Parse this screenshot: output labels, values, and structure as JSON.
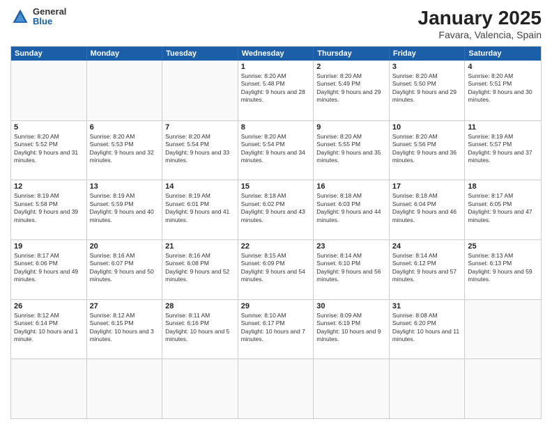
{
  "header": {
    "logo_general": "General",
    "logo_blue": "Blue",
    "title": "January 2025",
    "location": "Favara, Valencia, Spain"
  },
  "calendar": {
    "days_of_week": [
      "Sunday",
      "Monday",
      "Tuesday",
      "Wednesday",
      "Thursday",
      "Friday",
      "Saturday"
    ],
    "weeks": [
      [
        {
          "day": "",
          "empty": true
        },
        {
          "day": "",
          "empty": true
        },
        {
          "day": "",
          "empty": true
        },
        {
          "day": "1",
          "sunrise": "Sunrise: 8:20 AM",
          "sunset": "Sunset: 5:48 PM",
          "daylight": "Daylight: 9 hours and 28 minutes."
        },
        {
          "day": "2",
          "sunrise": "Sunrise: 8:20 AM",
          "sunset": "Sunset: 5:49 PM",
          "daylight": "Daylight: 9 hours and 29 minutes."
        },
        {
          "day": "3",
          "sunrise": "Sunrise: 8:20 AM",
          "sunset": "Sunset: 5:50 PM",
          "daylight": "Daylight: 9 hours and 29 minutes."
        },
        {
          "day": "4",
          "sunrise": "Sunrise: 8:20 AM",
          "sunset": "Sunset: 5:51 PM",
          "daylight": "Daylight: 9 hours and 30 minutes."
        }
      ],
      [
        {
          "day": "5",
          "sunrise": "Sunrise: 8:20 AM",
          "sunset": "Sunset: 5:52 PM",
          "daylight": "Daylight: 9 hours and 31 minutes."
        },
        {
          "day": "6",
          "sunrise": "Sunrise: 8:20 AM",
          "sunset": "Sunset: 5:53 PM",
          "daylight": "Daylight: 9 hours and 32 minutes."
        },
        {
          "day": "7",
          "sunrise": "Sunrise: 8:20 AM",
          "sunset": "Sunset: 5:54 PM",
          "daylight": "Daylight: 9 hours and 33 minutes."
        },
        {
          "day": "8",
          "sunrise": "Sunrise: 8:20 AM",
          "sunset": "Sunset: 5:54 PM",
          "daylight": "Daylight: 9 hours and 34 minutes."
        },
        {
          "day": "9",
          "sunrise": "Sunrise: 8:20 AM",
          "sunset": "Sunset: 5:55 PM",
          "daylight": "Daylight: 9 hours and 35 minutes."
        },
        {
          "day": "10",
          "sunrise": "Sunrise: 8:20 AM",
          "sunset": "Sunset: 5:56 PM",
          "daylight": "Daylight: 9 hours and 36 minutes."
        },
        {
          "day": "11",
          "sunrise": "Sunrise: 8:19 AM",
          "sunset": "Sunset: 5:57 PM",
          "daylight": "Daylight: 9 hours and 37 minutes."
        }
      ],
      [
        {
          "day": "12",
          "sunrise": "Sunrise: 8:19 AM",
          "sunset": "Sunset: 5:58 PM",
          "daylight": "Daylight: 9 hours and 39 minutes."
        },
        {
          "day": "13",
          "sunrise": "Sunrise: 8:19 AM",
          "sunset": "Sunset: 5:59 PM",
          "daylight": "Daylight: 9 hours and 40 minutes."
        },
        {
          "day": "14",
          "sunrise": "Sunrise: 8:19 AM",
          "sunset": "Sunset: 6:01 PM",
          "daylight": "Daylight: 9 hours and 41 minutes."
        },
        {
          "day": "15",
          "sunrise": "Sunrise: 8:18 AM",
          "sunset": "Sunset: 6:02 PM",
          "daylight": "Daylight: 9 hours and 43 minutes."
        },
        {
          "day": "16",
          "sunrise": "Sunrise: 8:18 AM",
          "sunset": "Sunset: 6:03 PM",
          "daylight": "Daylight: 9 hours and 44 minutes."
        },
        {
          "day": "17",
          "sunrise": "Sunrise: 8:18 AM",
          "sunset": "Sunset: 6:04 PM",
          "daylight": "Daylight: 9 hours and 46 minutes."
        },
        {
          "day": "18",
          "sunrise": "Sunrise: 8:17 AM",
          "sunset": "Sunset: 6:05 PM",
          "daylight": "Daylight: 9 hours and 47 minutes."
        }
      ],
      [
        {
          "day": "19",
          "sunrise": "Sunrise: 8:17 AM",
          "sunset": "Sunset: 6:06 PM",
          "daylight": "Daylight: 9 hours and 49 minutes."
        },
        {
          "day": "20",
          "sunrise": "Sunrise: 8:16 AM",
          "sunset": "Sunset: 6:07 PM",
          "daylight": "Daylight: 9 hours and 50 minutes."
        },
        {
          "day": "21",
          "sunrise": "Sunrise: 8:16 AM",
          "sunset": "Sunset: 6:08 PM",
          "daylight": "Daylight: 9 hours and 52 minutes."
        },
        {
          "day": "22",
          "sunrise": "Sunrise: 8:15 AM",
          "sunset": "Sunset: 6:09 PM",
          "daylight": "Daylight: 9 hours and 54 minutes."
        },
        {
          "day": "23",
          "sunrise": "Sunrise: 8:14 AM",
          "sunset": "Sunset: 6:10 PM",
          "daylight": "Daylight: 9 hours and 56 minutes."
        },
        {
          "day": "24",
          "sunrise": "Sunrise: 8:14 AM",
          "sunset": "Sunset: 6:12 PM",
          "daylight": "Daylight: 9 hours and 57 minutes."
        },
        {
          "day": "25",
          "sunrise": "Sunrise: 8:13 AM",
          "sunset": "Sunset: 6:13 PM",
          "daylight": "Daylight: 9 hours and 59 minutes."
        }
      ],
      [
        {
          "day": "26",
          "sunrise": "Sunrise: 8:12 AM",
          "sunset": "Sunset: 6:14 PM",
          "daylight": "Daylight: 10 hours and 1 minute."
        },
        {
          "day": "27",
          "sunrise": "Sunrise: 8:12 AM",
          "sunset": "Sunset: 6:15 PM",
          "daylight": "Daylight: 10 hours and 3 minutes."
        },
        {
          "day": "28",
          "sunrise": "Sunrise: 8:11 AM",
          "sunset": "Sunset: 6:16 PM",
          "daylight": "Daylight: 10 hours and 5 minutes."
        },
        {
          "day": "29",
          "sunrise": "Sunrise: 8:10 AM",
          "sunset": "Sunset: 6:17 PM",
          "daylight": "Daylight: 10 hours and 7 minutes."
        },
        {
          "day": "30",
          "sunrise": "Sunrise: 8:09 AM",
          "sunset": "Sunset: 6:19 PM",
          "daylight": "Daylight: 10 hours and 9 minutes."
        },
        {
          "day": "31",
          "sunrise": "Sunrise: 8:08 AM",
          "sunset": "Sunset: 6:20 PM",
          "daylight": "Daylight: 10 hours and 11 minutes."
        },
        {
          "day": "",
          "empty": true
        }
      ],
      [
        {
          "day": "",
          "empty": true
        },
        {
          "day": "",
          "empty": true
        },
        {
          "day": "",
          "empty": true
        },
        {
          "day": "",
          "empty": true
        },
        {
          "day": "",
          "empty": true
        },
        {
          "day": "",
          "empty": true
        },
        {
          "day": "",
          "empty": true
        }
      ]
    ]
  }
}
